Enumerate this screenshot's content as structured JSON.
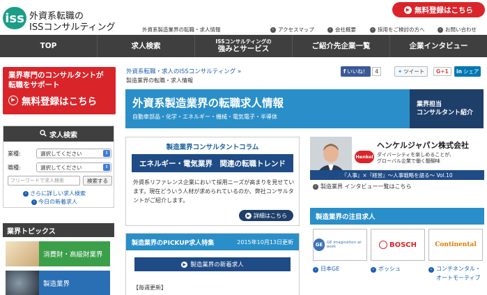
{
  "header": {
    "logo_mark": "iss",
    "logo_line1": "外資系転職の",
    "logo_line2": "ISSコンサルティング",
    "tagline": "外資系製造業界の転職・求人情報",
    "register_button": "無料登録はこちら",
    "util_links": [
      "アクセスマップ",
      "会社概要",
      "採用をご検討の方へ",
      "お問い合わせ"
    ]
  },
  "nav": {
    "items": [
      {
        "label": "TOP"
      },
      {
        "label": "求人検索"
      },
      {
        "label": "ISSコンサルティングの",
        "sub": "強みとサービス"
      },
      {
        "label": "ご紹介先企業一覧"
      },
      {
        "label": "企業インタビュー"
      }
    ]
  },
  "left_banner": {
    "line1": "業界専門のコンサルタントが",
    "line2": "転職をサポート",
    "cta": "無料登録はこちら"
  },
  "search": {
    "title": "求人検索",
    "industry_label": "業種:",
    "industry_value": "選択してください",
    "job_label": "職種:",
    "job_value": "選択してください",
    "keyword_placeholder": "フリーワードで求人検索",
    "search_button": "検索する",
    "link_detail": "さらに詳しい求人検索",
    "link_new": "今日の新着求人"
  },
  "topics": {
    "title": "業界トピックス",
    "items": [
      {
        "label": "消費財・高級財業界"
      },
      {
        "label": "製造業界"
      }
    ]
  },
  "breadcrumb": {
    "parent": "外資系転職・求人のISSコンサルティング",
    "current": "製造業界の転職・求人情報"
  },
  "social": {
    "like": "いいね！",
    "like_count": "4",
    "tweet": "ツイート",
    "gplus": "G+1",
    "share": "シェア"
  },
  "hero": {
    "title": "外資系製造業界の転職求人情報",
    "subtitle": "自動車部品・化学・エネルギー・機械・電気電子・半導体",
    "side_line1": "業界担当",
    "side_line2": "コンサルタント紹介"
  },
  "column": {
    "title": "製造業界コンサルタントコラム",
    "banner": "エネルギー・電気業界　関連の転職トレンド",
    "text": "外資系リファレンス企業において採用ニーズが高まりを見せています。現在どういう人材が求められているのか、弊社コンサルタントがご紹介します。",
    "button": "詳細はこちら"
  },
  "pickup": {
    "title": "製造業界のPICKUP求人特集",
    "date": "2015年10月13日更新",
    "button": "製造業界の新着求人",
    "note": "【毎週更新】"
  },
  "ad": {
    "company": "ヘンケルジャパン株式会社",
    "copy_line1": "ダイバーシティを楽しめることが、",
    "copy_line2": "グローバル企業で働く醍醐味",
    "logo": "Henkel",
    "strip": "『人事』×『経営』〜人事戦略を語る〜 Vol.10",
    "link": "製造業界 インタビュー一覧はこちら"
  },
  "featured": {
    "title": "製造業界の注目求人",
    "companies": [
      {
        "logo": "GE imagination at work",
        "label": "日本GE"
      },
      {
        "logo": "BOSCH",
        "label": "ボッシュ"
      },
      {
        "logo": "Continental",
        "label": "コンチネンタル・オートモーティブ"
      }
    ]
  }
}
